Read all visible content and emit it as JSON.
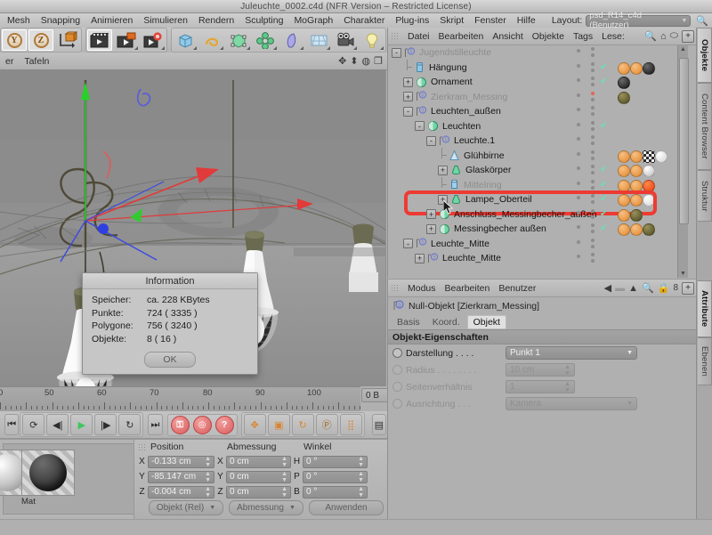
{
  "window": {
    "title": "Juleuchte_0002.c4d (NFR Version – Restricted License)"
  },
  "menubar": {
    "items": [
      "Mesh",
      "Snapping",
      "Animieren",
      "Simulieren",
      "Rendern",
      "Sculpting",
      "MoGraph",
      "Charakter",
      "Plug-ins",
      "Skript",
      "Fenster",
      "Hilfe"
    ],
    "layout_label": "Layout:",
    "layout_value": "psd_R14_c4d (Benutzer)",
    "search_icon": "search-icon"
  },
  "toolbar": {
    "axis_buttons": [
      "Y",
      "Z"
    ],
    "icons": [
      "axis-object-icon",
      "render-view-icon",
      "render-region-icon",
      "render-settings-icon",
      "cube-icon",
      "spline-icon",
      "deformer-icon",
      "mograph-icon",
      "nurbs-icon",
      "floor-icon",
      "camera-icon",
      "light-icon"
    ]
  },
  "strip2": {
    "items": [
      "er",
      "Tafeln"
    ],
    "right_icons": [
      "move-icon",
      "scale-icon",
      "rotate-icon",
      "window-icon"
    ]
  },
  "viewport": {
    "gizmo_axes": [
      "x",
      "y",
      "z"
    ]
  },
  "info_dialog": {
    "title": "Information",
    "rows": [
      {
        "key": "Speicher:",
        "value": "ca. 228 KBytes"
      },
      {
        "key": "Punkte:",
        "value": "724 ( 3335 )"
      },
      {
        "key": "Polygone:",
        "value": "756 ( 3240 )"
      },
      {
        "key": "Objekte:",
        "value": "8 ( 16 )"
      }
    ],
    "ok_label": "OK"
  },
  "timeline": {
    "ticks": [
      "0",
      "50",
      "60",
      "70",
      "80",
      "90",
      "100"
    ],
    "frame_field": "0 B",
    "transport": [
      "go-to-start-icon",
      "play-backward-loop-icon",
      "step-back-icon",
      "play-icon",
      "step-forward-icon",
      "loop-icon",
      "go-to-end-icon"
    ],
    "record_buttons": [
      "record-key-icon",
      "autokey-icon",
      "key-selection-icon"
    ],
    "key_filters": [
      "position-key-icon",
      "scale-key-icon",
      "rotation-key-icon",
      "parameter-key-icon",
      "points-key-icon"
    ],
    "timeline_icon": "timeline-icon"
  },
  "materials": {
    "items": [
      {
        "label": "",
        "name": "material-thumb-partial"
      },
      {
        "label": "Mat",
        "name": "material-mat"
      }
    ]
  },
  "coordinates": {
    "headers": [
      "Position",
      "Abmessung",
      "Winkel"
    ],
    "position": [
      {
        "axis": "X",
        "value": "-0.133 cm"
      },
      {
        "axis": "Y",
        "value": "-85.147 cm"
      },
      {
        "axis": "Z",
        "value": "-0.004 cm"
      }
    ],
    "size": [
      {
        "axis": "X",
        "value": "0 cm"
      },
      {
        "axis": "Y",
        "value": "0 cm"
      },
      {
        "axis": "Z",
        "value": "0 cm"
      }
    ],
    "angle": [
      {
        "axis": "H",
        "value": "0 °"
      },
      {
        "axis": "P",
        "value": "0 °"
      },
      {
        "axis": "B",
        "value": "0 °"
      }
    ],
    "mode_dropdown": "Objekt (Rel)",
    "size_dropdown": "Abmessung",
    "apply_button": "Anwenden"
  },
  "object_manager": {
    "menu": [
      "Datei",
      "Bearbeiten",
      "Ansicht",
      "Objekte",
      "Tags",
      "Lese:"
    ],
    "icons": [
      "search-icon",
      "home-icon",
      "ellipse-icon",
      "plus-box-icon"
    ],
    "tree": [
      {
        "label": "Jugendstilleuchte",
        "depth": 0,
        "expander": "-",
        "icon": "null-object-icon",
        "dim": true,
        "check": false,
        "dotRed": false,
        "tags": []
      },
      {
        "label": "Hängung",
        "depth": 1,
        "expander": "",
        "icon": "cube-object-icon",
        "dim": false,
        "check": true,
        "dotRed": false,
        "tags": [
          "tag-orange",
          "tag-orange",
          "tag-black"
        ]
      },
      {
        "label": "Ornament",
        "depth": 1,
        "expander": "+",
        "icon": "polygon-object-icon",
        "dim": false,
        "check": true,
        "dotRed": false,
        "tags": [
          "tag-black"
        ]
      },
      {
        "label": "Zierkram_Messing",
        "depth": 1,
        "expander": "+",
        "icon": "null-object-icon",
        "dim": true,
        "check": false,
        "dotRed": true,
        "tags": [
          "tag-brass"
        ]
      },
      {
        "label": "Leuchten_außen",
        "depth": 1,
        "expander": "-",
        "icon": "null-object-icon",
        "dim": false,
        "check": false,
        "dotRed": false,
        "tags": []
      },
      {
        "label": "Leuchten",
        "depth": 2,
        "expander": "-",
        "icon": "polygon-object-icon",
        "dim": false,
        "check": true,
        "dotRed": false,
        "tags": []
      },
      {
        "label": "Leuchte.1",
        "depth": 3,
        "expander": "-",
        "icon": "null-object-icon",
        "dim": false,
        "check": false,
        "dotRed": false,
        "tags": []
      },
      {
        "label": "Glühbirne",
        "depth": 4,
        "expander": "",
        "icon": "cone-object-icon",
        "dim": false,
        "check": false,
        "dotRed": false,
        "tags": [
          "tag-orange",
          "tag-orange",
          "tag-checker",
          "tag-white"
        ]
      },
      {
        "label": "Glaskörper",
        "depth": 4,
        "expander": "+",
        "icon": "lathe-object-icon",
        "dim": false,
        "check": true,
        "dotRed": false,
        "tags": [
          "tag-orange",
          "tag-orange",
          "tag-glass"
        ]
      },
      {
        "label": "Mittelring",
        "depth": 4,
        "expander": "",
        "icon": "cylinder-object-icon",
        "dim": true,
        "check": true,
        "dotRed": false,
        "tags": [
          "tag-orange",
          "tag-orange",
          "tag-red"
        ]
      },
      {
        "label": "Lampe_Oberteil",
        "depth": 4,
        "expander": "+",
        "icon": "lathe-object-icon",
        "dim": false,
        "check": true,
        "dotRed": false,
        "highlight": true,
        "tags": [
          "tag-orange",
          "tag-orange",
          "tag-white"
        ]
      },
      {
        "label": "Anschluss_Messingbecher_außen",
        "depth": 3,
        "expander": "+",
        "icon": "polygon-object-icon",
        "dim": false,
        "check": true,
        "dotRed": false,
        "tags": [
          "tag-orange",
          "tag-brass"
        ]
      },
      {
        "label": "Messingbecher außen",
        "depth": 3,
        "expander": "+",
        "icon": "polygon-object-icon",
        "dim": false,
        "check": true,
        "dotRed": false,
        "tags": [
          "tag-orange",
          "tag-orange",
          "tag-brass"
        ]
      },
      {
        "label": "Leuchte_Mitte",
        "depth": 1,
        "expander": "-",
        "icon": "null-object-icon",
        "dim": false,
        "check": false,
        "dotRed": false,
        "tags": []
      },
      {
        "label": "Leuchte_Mitte",
        "depth": 2,
        "expander": "+",
        "icon": "null-object-icon",
        "dim": false,
        "check": false,
        "dotRed": false,
        "tags": []
      }
    ]
  },
  "attribute_manager": {
    "menu": [
      "Modus",
      "Bearbeiten",
      "Benutzer"
    ],
    "nav_icons": [
      "back-arrow-icon",
      "up-arrow-icon",
      "search-icon",
      "lock-icon",
      "history-count-icon",
      "plus-box-icon"
    ],
    "history_count": "8",
    "object_title": "Null-Objekt [Zierkram_Messing]",
    "tabs": [
      {
        "label": "Basis",
        "active": false
      },
      {
        "label": "Koord.",
        "active": false
      },
      {
        "label": "Objekt",
        "active": true
      }
    ],
    "section_title": "Objekt-Eigenschaften",
    "properties": [
      {
        "label": "Darstellung . . . .",
        "type": "dropdown",
        "value": "Punkt 1",
        "enabled": true
      },
      {
        "label": "Radius . . . . . . . .",
        "type": "number",
        "value": "10 cm",
        "enabled": false
      },
      {
        "label": "Seitenverhältnis",
        "type": "number",
        "value": "1",
        "enabled": false
      },
      {
        "label": "Ausrichtung . . .",
        "type": "dropdown",
        "value": "Kamera",
        "enabled": false
      }
    ]
  },
  "side_tabs": {
    "upper": [
      {
        "label": "Objekte",
        "active": true
      },
      {
        "label": "Content Browser",
        "active": false
      },
      {
        "label": "Struktur",
        "active": false
      }
    ],
    "lower": [
      {
        "label": "Attribute",
        "active": true
      },
      {
        "label": "Ebenen",
        "active": false
      }
    ]
  },
  "colors": {
    "highlight_red": "#ed3b33",
    "check_green": "#68e0b8",
    "tag_orange": "#e8933a",
    "accent_brass": "#6f6a33"
  }
}
